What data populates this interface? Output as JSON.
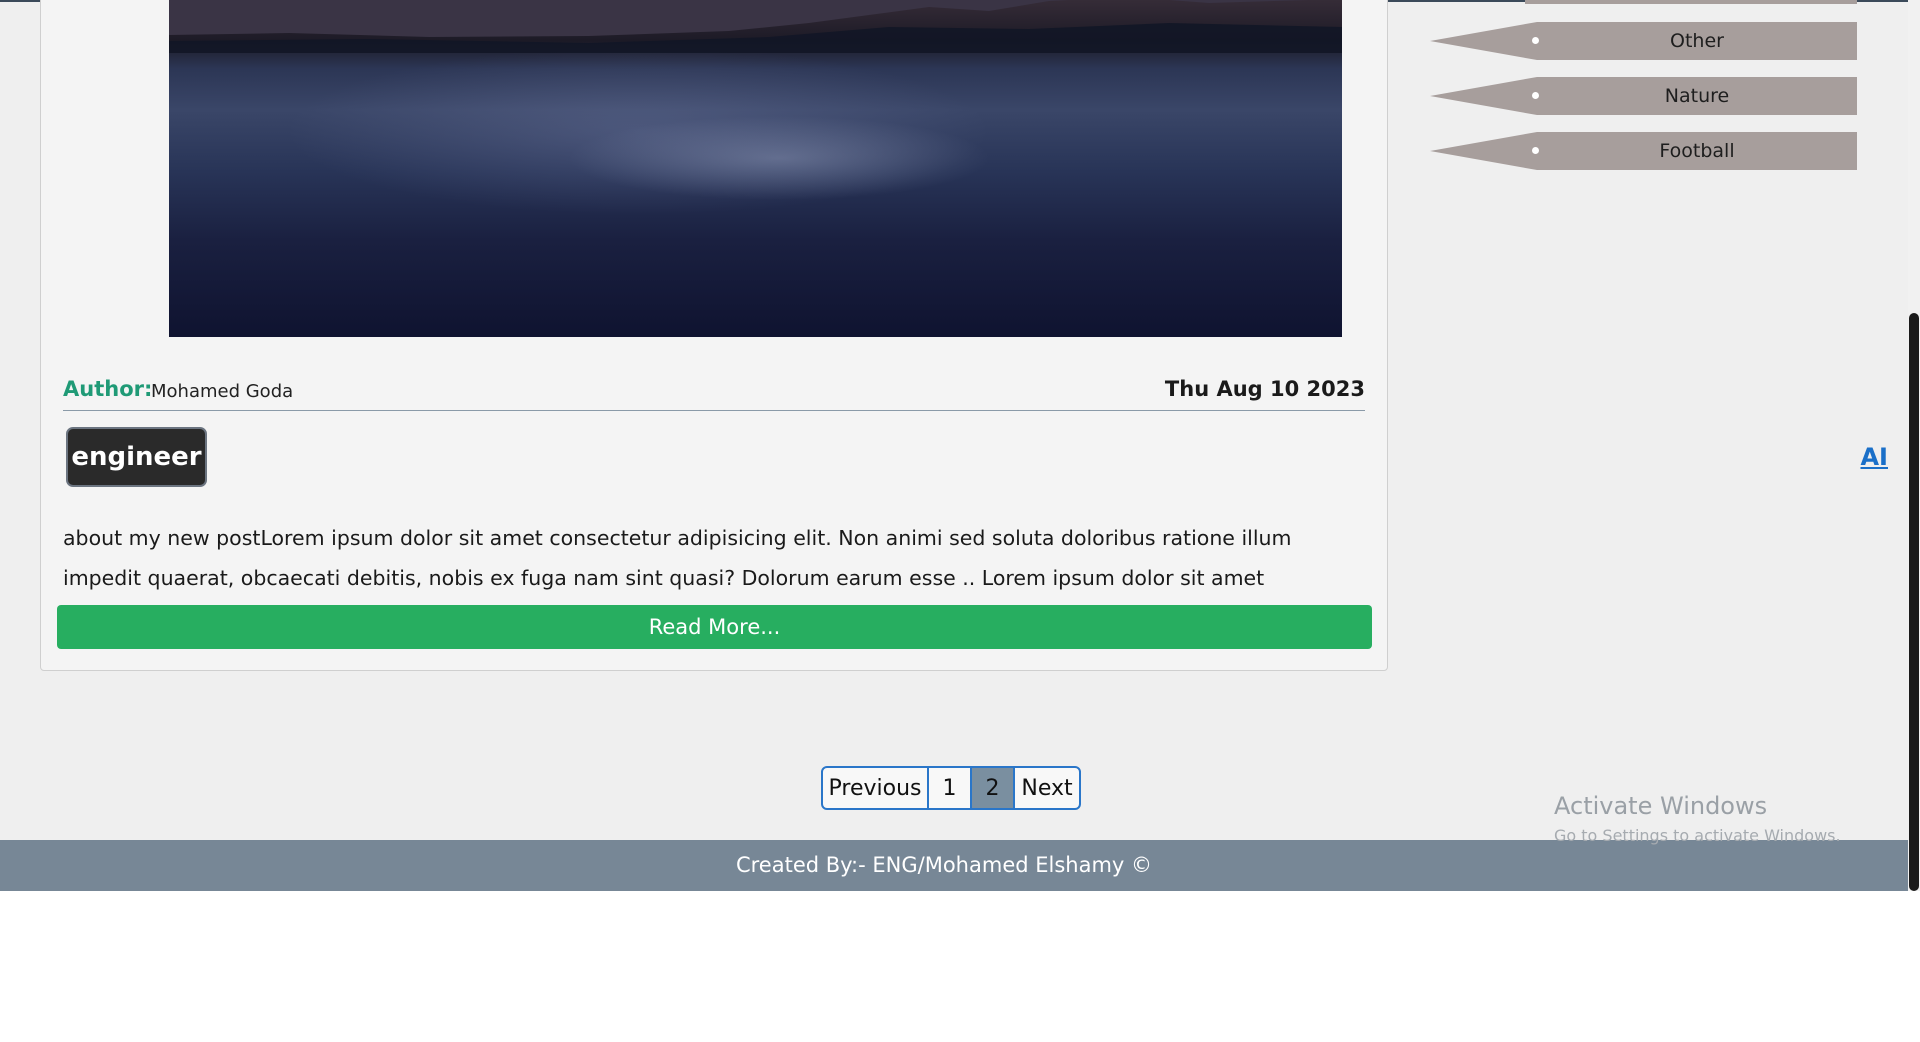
{
  "post": {
    "author_label": "Author:",
    "author_name": "Mohamed Goda",
    "date": "Thu Aug 10 2023",
    "tag": "engineer",
    "category": "AI",
    "excerpt": "about my new postLorem ipsum dolor sit amet consectetur adipisicing elit. Non animi sed soluta doloribus ratione illum impedit quaerat, obcaecati debitis, nobis ex fuga nam sint quasi? Dolorum earum esse .. Lorem ipsum dolor sit amet consectetur adipisicing...",
    "read_more_label": "Read More..."
  },
  "sidebar": {
    "categories": [
      {
        "label": "Other"
      },
      {
        "label": "Nature"
      },
      {
        "label": "Football"
      }
    ]
  },
  "pagination": {
    "previous_label": "Previous",
    "pages": [
      "1",
      "2"
    ],
    "active_page": "2",
    "next_label": "Next"
  },
  "watermark": {
    "title": "Activate Windows",
    "subtitle": "Go to Settings to activate Windows."
  },
  "footer": {
    "text": "Created By:- ENG/Mohamed Elshamy ©"
  },
  "colors": {
    "author_accent": "#1f9a76",
    "read_more_bg": "#27ae60",
    "link_blue": "#1a6fc8",
    "sidebar_item_bg": "#a79e9c",
    "footer_bg": "#778796",
    "pagination_border": "#2a76c9",
    "active_page_bg": "#7a8fa0"
  }
}
